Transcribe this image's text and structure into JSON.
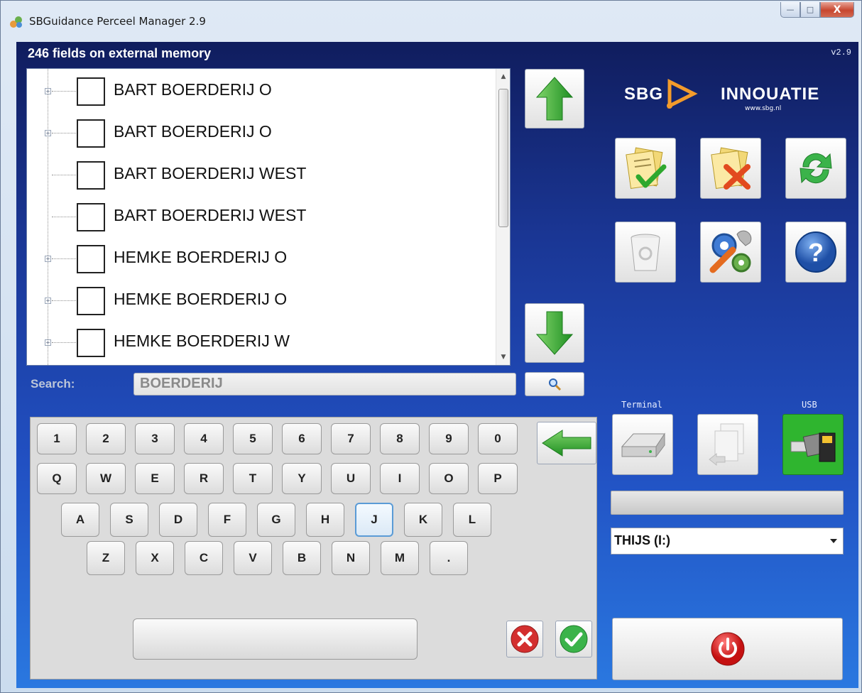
{
  "window": {
    "title": "SBGuidance Perceel Manager 2.9",
    "controls": {
      "minimize": "—",
      "maximize": "□",
      "close": "X"
    }
  },
  "header": {
    "title": "246 fields on external memory",
    "version": "v2.9"
  },
  "logo": {
    "left": "SBG",
    "right": "INNOUATIE",
    "url": "www.sbg.nl"
  },
  "fields": [
    {
      "label": "BART BOERDERIJ O",
      "expandable": true
    },
    {
      "label": "BART BOERDERIJ O",
      "expandable": true
    },
    {
      "label": "BART BOERDERIJ WEST",
      "expandable": false
    },
    {
      "label": "BART BOERDERIJ WEST",
      "expandable": false
    },
    {
      "label": "HEMKE BOERDERIJ O",
      "expandable": true
    },
    {
      "label": "HEMKE BOERDERIJ O",
      "expandable": true
    },
    {
      "label": "HEMKE BOERDERIJ W",
      "expandable": true
    }
  ],
  "search": {
    "label": "Search:",
    "value": "BOERDERIJ"
  },
  "keyboard": {
    "row1": [
      "1",
      "2",
      "3",
      "4",
      "5",
      "6",
      "7",
      "8",
      "9",
      "0"
    ],
    "row2": [
      "Q",
      "W",
      "E",
      "R",
      "T",
      "Y",
      "U",
      "I",
      "O",
      "P"
    ],
    "row3": [
      "A",
      "S",
      "D",
      "F",
      "G",
      "H",
      "J",
      "K",
      "L"
    ],
    "row4": [
      "Z",
      "X",
      "C",
      "V",
      "B",
      "N",
      "M",
      "."
    ],
    "focused_key": "J"
  },
  "transfer": {
    "terminal_label": "Terminal",
    "usb_label": "USB",
    "drive_selected": "THIJS (I:)"
  },
  "colors": {
    "accent_green": "#2ea82e",
    "usb_active": "#2fb52f",
    "power_red": "#d81e1e"
  }
}
